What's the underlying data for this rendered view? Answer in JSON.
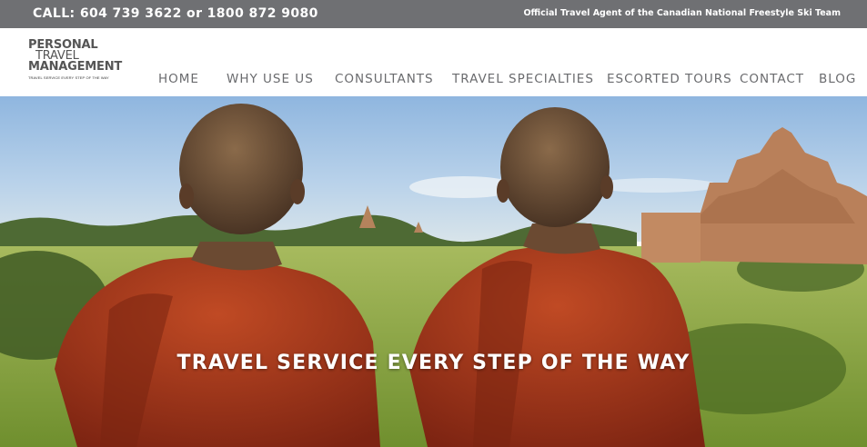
{
  "topbar": {
    "phone_text": "CALL: 604 739 3622   or 1800 872 9080",
    "official_text": "Official Travel Agent of the Canadian National Freestyle Ski Team",
    "background": "#6f7073"
  },
  "logo": {
    "line1": "PERSONAL",
    "line2": "TRAVEL",
    "line3": "MANAGEMENT",
    "tagline": "TRAVEL SERVICE EVERY STEP OF THE WAY"
  },
  "nav": {
    "items": [
      "HOME",
      "WHY USE US",
      "CONSULTANTS",
      "TRAVEL SPECIALTIES",
      "ESCORTED TOURS",
      "CONTACT",
      "BLOG"
    ],
    "color": "#6a6b6e"
  },
  "hero": {
    "headline": "TRAVEL SERVICE EVERY STEP OF THE WAY",
    "robe_color": "#a8391c",
    "sky_color": "#9fc2e4"
  }
}
